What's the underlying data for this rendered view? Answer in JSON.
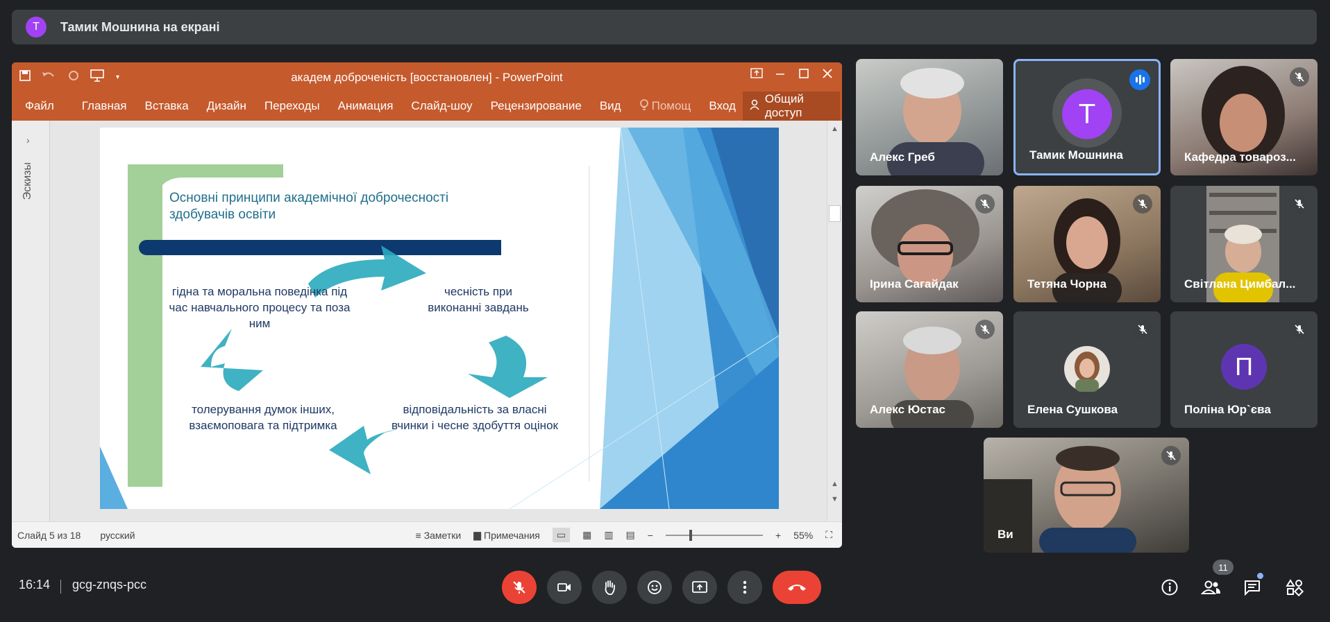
{
  "banner": {
    "avatar_letter": "T",
    "text": "Тамик Мошнина на екрані"
  },
  "ppt": {
    "doc_title": "академ доброченість [восстановлен] - PowerPoint",
    "tabs": [
      "Файл",
      "Главная",
      "Вставка",
      "Дизайн",
      "Переходы",
      "Анимация",
      "Слайд-шоу",
      "Рецензирование",
      "Вид"
    ],
    "help": "Помощ",
    "login": "Вход",
    "share": "Общий доступ",
    "thumbs_label": "Эскизы",
    "slide": {
      "title": "Основні принципи академічної доброчесності здобувачів освіти",
      "item_1": "гідна та моральна поведінка під час навчального процесу та поза ним",
      "item_2": "чесність при виконанні завдань",
      "item_3": "відповідальність за власні вчинки і чесне здобуття оцінок",
      "item_4": "толерування думок інших, взаємоповага та підтримка"
    },
    "status": {
      "slide": "Слайд 5 из 18",
      "lang": "русский",
      "notes": "Заметки",
      "comments": "Примечания",
      "zoom": "55%"
    }
  },
  "participants": [
    {
      "name": "Алекс Греб",
      "video": true,
      "muted": false
    },
    {
      "name": "Тамик Мошнина",
      "video": false,
      "avatar": "T",
      "avatar_color": "#a142f4",
      "speaking": true
    },
    {
      "name": "Кафедра товароз...",
      "video": true,
      "muted": true
    },
    {
      "name": "Ірина Сагайдак",
      "video": true,
      "muted": true
    },
    {
      "name": "Тетяна Чорна",
      "video": true,
      "muted": true
    },
    {
      "name": "Світлана Цимбал...",
      "video": true,
      "muted": true
    },
    {
      "name": "Алекс Юстас",
      "video": true,
      "muted": true
    },
    {
      "name": "Елена Сушкова",
      "video": false,
      "photo_avatar": true,
      "muted": true
    },
    {
      "name": "Поліна Юр`єва",
      "video": false,
      "avatar": "П",
      "avatar_color": "#5e35b1",
      "muted": true
    },
    {
      "name": "Ви",
      "video": true,
      "muted": true
    }
  ],
  "meeting": {
    "time": "16:14",
    "code": "gcg-znqs-pcc",
    "people_count": "11"
  },
  "icons": {
    "mic_off": "mic-off-icon",
    "camera": "camera-icon",
    "hand": "raise-hand-icon",
    "emoji": "emoji-icon",
    "present": "present-icon",
    "more": "more-icon",
    "hangup": "hangup-icon",
    "info": "info-icon",
    "people": "people-icon",
    "chat": "chat-icon",
    "activities": "activities-icon"
  },
  "colors": {
    "accent_blue": "#1a73e8",
    "danger": "#ea4335",
    "ppt_orange": "#c55a2d"
  }
}
